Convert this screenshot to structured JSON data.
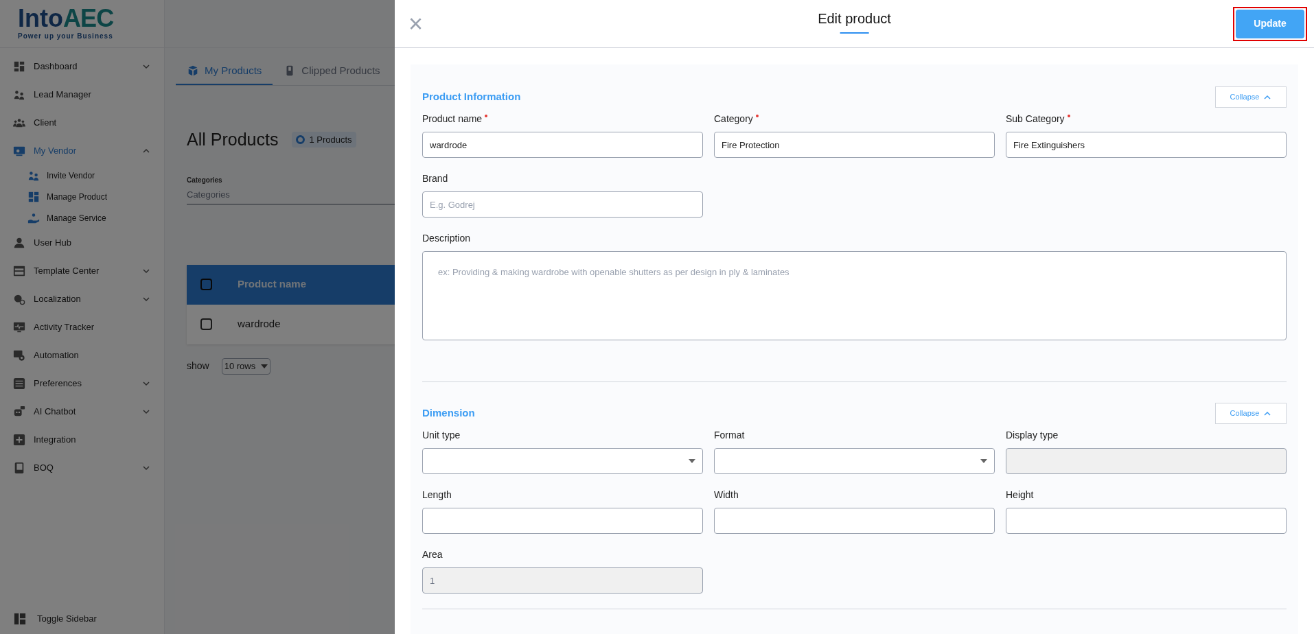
{
  "sidebar": {
    "logo": {
      "wordmark": [
        "Into",
        "AEC"
      ],
      "tagline": "Power up your Business"
    },
    "items": [
      {
        "label": "Dashboard",
        "selected": false,
        "expanded": false
      },
      {
        "label": "Lead Manager",
        "selected": false
      },
      {
        "label": "Client",
        "selected": false
      },
      {
        "label": "My Vendor",
        "selected": true,
        "expanded": true,
        "children": [
          {
            "label": "Invite Vendor",
            "selected": false
          },
          {
            "label": "Manage Product",
            "selected": false
          },
          {
            "label": "Manage Service",
            "selected": false
          }
        ]
      },
      {
        "label": "User Hub",
        "selected": false
      },
      {
        "label": "Template Center",
        "selected": false,
        "expanded": false
      },
      {
        "label": "Localization",
        "selected": false,
        "expanded": false
      },
      {
        "label": "Activity Tracker",
        "selected": false
      },
      {
        "label": "Automation",
        "selected": false
      },
      {
        "label": "Preferences",
        "selected": false,
        "expanded": false
      },
      {
        "label": "AI Chatbot",
        "selected": false,
        "expanded": false
      },
      {
        "label": "Integration",
        "selected": false
      },
      {
        "label": "BOQ",
        "selected": false,
        "expanded": false
      }
    ],
    "toggle": "Toggle Sidebar"
  },
  "main": {
    "tabs": [
      {
        "label": "My Products",
        "selected": true
      },
      {
        "label": "Clipped Products",
        "selected": false
      }
    ],
    "title": "All Products",
    "count_badge": "1 Products",
    "filter": {
      "label": "Categories",
      "placeholder": "Categories"
    },
    "table": {
      "columns": [
        "Product name"
      ],
      "rows": [
        {
          "cells": [
            "wardrode"
          ],
          "checked": false
        }
      ],
      "header_checked": false
    },
    "pagination": {
      "label": "show",
      "rows": "10 rows"
    }
  },
  "modal": {
    "title": "Edit product",
    "close": "×",
    "update_button": "Update",
    "sections": [
      {
        "title": "Product Information",
        "collapse": "Collapse",
        "fields": [
          {
            "label": "Product name",
            "required": true,
            "kind": "text",
            "value": "wardrode"
          },
          {
            "label": "Category",
            "required": true,
            "kind": "text",
            "value": "Fire Protection"
          },
          {
            "label": "Sub Category",
            "required": true,
            "kind": "text",
            "value": "Fire Extinguishers"
          },
          {
            "label": "Brand",
            "required": false,
            "kind": "text",
            "placeholder": "E.g. Godrej"
          },
          {
            "label": "Description",
            "required": false,
            "kind": "textarea",
            "placeholder": "ex: Providing & making wardrobe with openable shutters as per design in ply & laminates"
          }
        ]
      },
      {
        "title": "Dimension",
        "collapse": "Collapse",
        "fields": [
          {
            "label": "Unit type",
            "required": false,
            "kind": "select"
          },
          {
            "label": "Format",
            "required": false,
            "kind": "select"
          },
          {
            "label": "Display type",
            "required": false,
            "kind": "text",
            "disabled": true
          },
          {
            "label": "Length",
            "required": false,
            "kind": "text"
          },
          {
            "label": "Width",
            "required": false,
            "kind": "text"
          },
          {
            "label": "Height",
            "required": false,
            "kind": "text"
          },
          {
            "label": "Area",
            "required": false,
            "kind": "text",
            "disabled": true,
            "value": "1"
          }
        ]
      }
    ]
  }
}
